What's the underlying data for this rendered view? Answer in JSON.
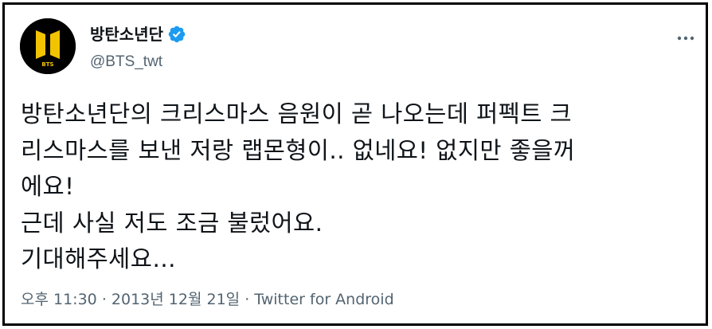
{
  "tweet": {
    "display_name": "방탄소년단",
    "handle": "@BTS_twt",
    "avatar_text": "BTS",
    "verified_icon": "verified-badge-icon",
    "more_icon": "more-horizontal-icon",
    "text_lines": [
      "방탄소년단의 크리스마스 음원이 곧 나오는데 퍼펙트 크",
      "리스마스를 보낸 저랑 랩몬형이.. 없네요! 없지만 좋을꺼",
      "에요!",
      "근데 사실 저도 조금 불렀어요.",
      "기대해주세요…"
    ],
    "time": "오후 11:30",
    "separator": "·",
    "date": "2013년 12월 21일",
    "source": "Twitter for Android"
  },
  "colors": {
    "text": "#0f1419",
    "secondary": "#536471",
    "verified": "#1d9bf0",
    "avatar_bg": "#000000",
    "logo_gold": "#f2c300"
  }
}
